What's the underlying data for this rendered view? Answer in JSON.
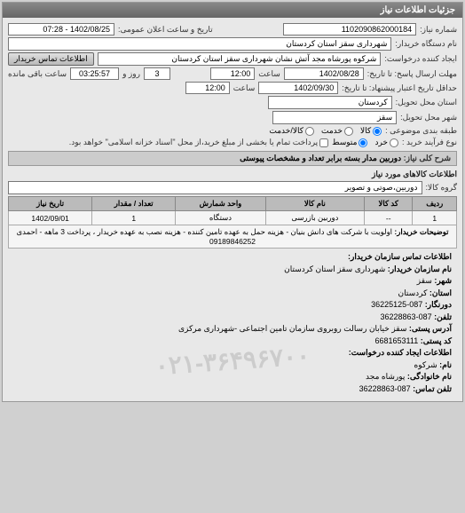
{
  "panel_title": "جزئیات اطلاعات نیاز",
  "labels": {
    "request_no": "شماره نیاز:",
    "announce_datetime": "تاریخ و ساعت اعلان عمومی:",
    "buyer_name": "نام دستگاه خریدار:",
    "requester_name": "ایجاد کننده درخواست:",
    "contact_btn": "اطلاعات تماس خریدار",
    "response_deadline": "مهلت ارسال پاسخ: تا تاریخ:",
    "hour": "ساعت",
    "days_remain": "روز و",
    "time_remain": "ساعت باقی مانده",
    "validity_min": "حداقل تاریخ اعتبار پیشنهاد: تا تاریخ:",
    "province": "استان محل تحویل:",
    "city": "شهر محل تحویل:",
    "subject_class": "طبقه بندی موضوعی :",
    "process_type": "نوع فرآیند خرید :",
    "process_note": "پرداخت تمام یا بخشی از مبلغ خرید،از محل \"اسناد خزانه اسلامی\" خواهد بود.",
    "need_title": "شرح کلی نیاز:",
    "items_section": "اطلاعات کالاهای مورد نیاز",
    "item_group": "گروه کالا:",
    "buyer_desc_label": "توضیحات خریدار:"
  },
  "values": {
    "request_no": "1102090862000184",
    "announce_datetime": "1402/08/25 - 07:28",
    "buyer_name": "شهرداری سقز استان کردستان",
    "requester_name": "شرکوه پورشاه مجد آتش نشان شهرداری سقز استان کردستان",
    "response_date": "1402/08/28",
    "response_hour": "12:00",
    "days_remain": "3",
    "time_remain": "03:25:57",
    "validity_date": "1402/09/30",
    "validity_hour": "12:00",
    "province": "کردستان",
    "city": "سقز",
    "need_title": "دوربین مدار بسته برابر تعداد و مشخصات پیوستی",
    "item_group": "دوربین،صوتی و تصویر",
    "buyer_desc": "اولویت با شرکت های دانش بنیان - هزینه حمل به عهده تامین کننده - هزینه نصب به عهده خریدار ، پرداخت 3 ماهه - احمدی 09189846252"
  },
  "radios": {
    "subject": {
      "opt1": "کالا",
      "opt2": "خدمت",
      "opt3": "کالا/خدمت"
    },
    "process": {
      "opt1": "خرد",
      "opt2": "متوسط"
    }
  },
  "table": {
    "headers": {
      "row": "ردیف",
      "code": "کد کالا",
      "name": "نام کالا",
      "unit": "واحد شمارش",
      "qty": "تعداد / مقدار",
      "date": "تاریخ نیاز"
    },
    "rows": [
      {
        "row": "1",
        "code": "--",
        "name": "دوربین بازرسی",
        "unit": "دستگاه",
        "qty": "1",
        "date": "1402/09/01"
      }
    ]
  },
  "contact": {
    "title": "اطلاعات تماس سازمان خریدار:",
    "org_label": "نام سازمان خریدار:",
    "org": "شهرداری سقز استان کردستان",
    "city_label": "شهر:",
    "city": "سقز",
    "province_label": "استان:",
    "province": "کردستان",
    "fax_label": "دورنگار:",
    "fax": "087-36225125",
    "tel_label": "تلفن:",
    "tel": "087-36228863",
    "addr_label": "آدرس پستی:",
    "addr": "سقز خیابان رسالت روبروی سازمان تامین اجتماعی -شهرداری مرکزی",
    "post_label": "کد پستی:",
    "post": "6681653111",
    "requester_title": "اطلاعات ایجاد کننده درخواست:",
    "rname_label": "نام:",
    "rname": "شرکوه",
    "rfamily_label": "نام خانوادگی:",
    "rfamily": "پورشاه مجد",
    "rtel_label": "تلفن تماس:",
    "rtel": "087-36228863"
  },
  "watermark": "۰۲۱-۳۶۴۹۶۷۰۰"
}
